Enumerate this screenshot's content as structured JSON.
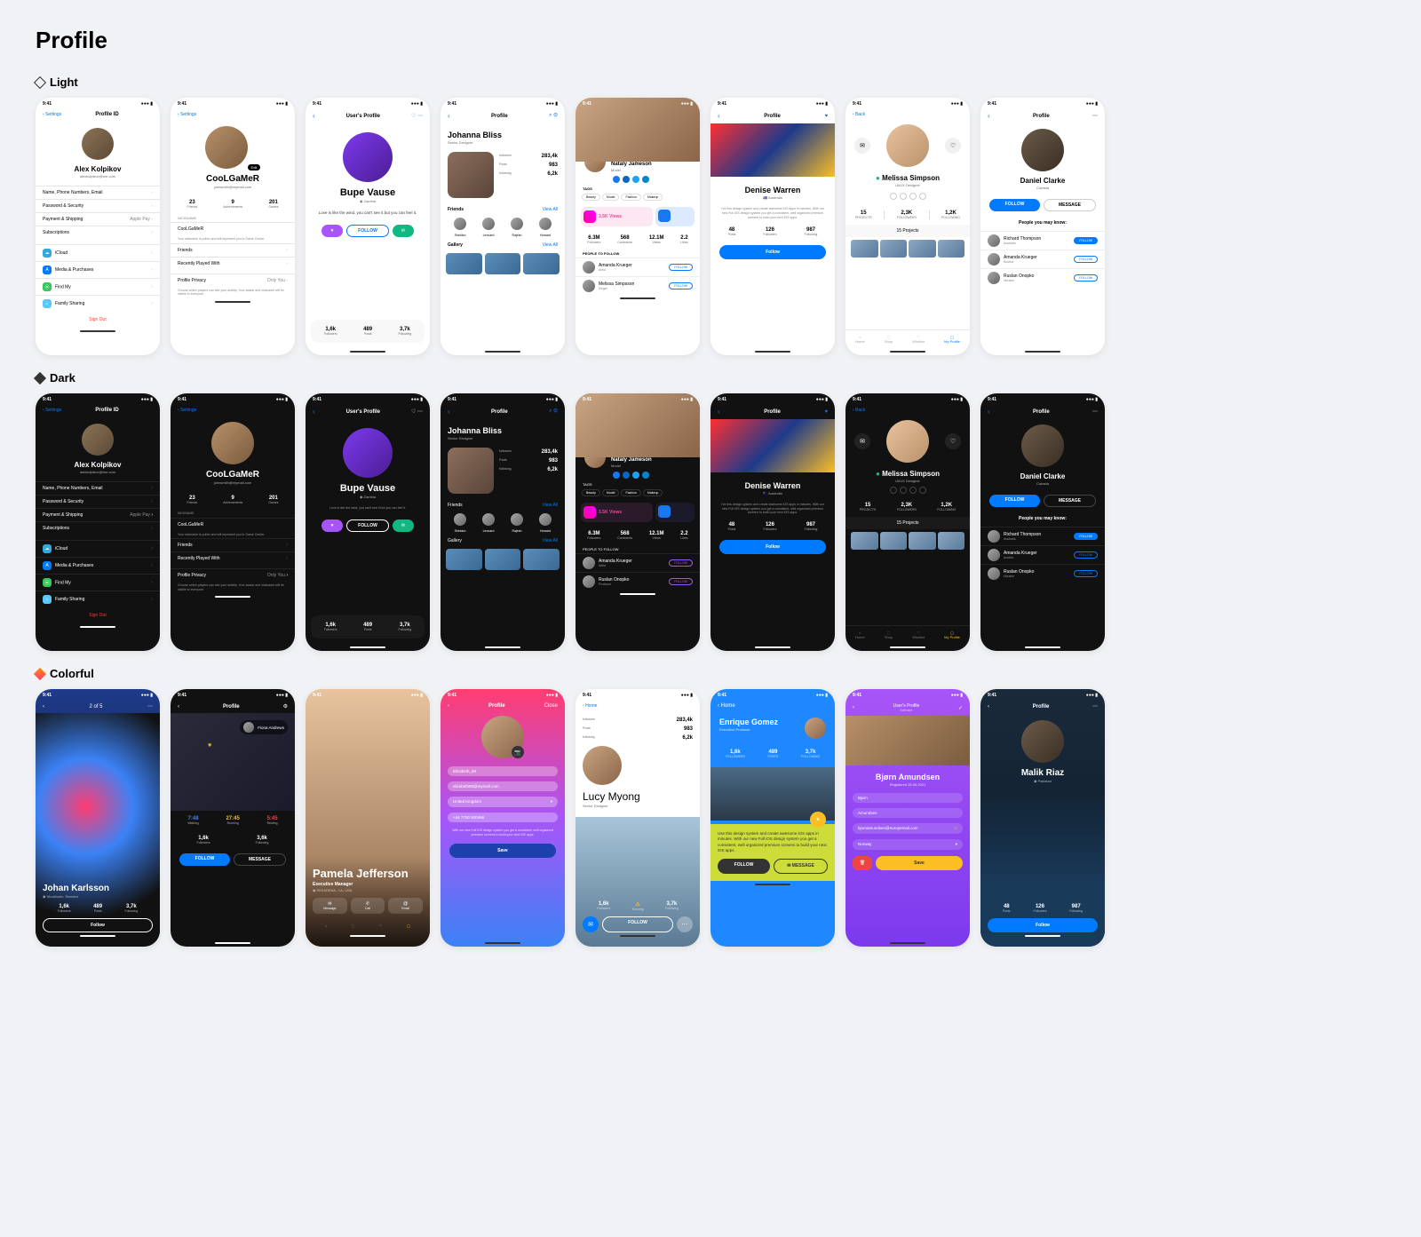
{
  "page_title": "Profile",
  "themes": {
    "light": "Light",
    "dark": "Dark",
    "colorful": "Colorful"
  },
  "time": "9:41",
  "screens": {
    "s1": {
      "back": "Settings",
      "title": "Profile ID",
      "name": "Alex Kolpikov",
      "email": "alexkolpikov@me.com",
      "rows": [
        "Name, Phone Numbers, Email",
        "Password & Security",
        "Payment & Shipping",
        "Subscriptions"
      ],
      "pay_hint": "Apple Pay",
      "services": [
        {
          "l": "iCloud",
          "c": "#34aadc"
        },
        {
          "l": "Media & Purchases",
          "c": "#007aff"
        },
        {
          "l": "Find My",
          "c": "#34c759"
        },
        {
          "l": "Family Sharing",
          "c": "#5ac8fa"
        }
      ],
      "signout": "Sign Out"
    },
    "s2": {
      "back": "Settings",
      "name": "CooLGaMeR",
      "email": "johnsmith@mymail.com",
      "stats": [
        {
          "v": "23",
          "l": "Friends"
        },
        {
          "v": "9",
          "l": "Achievements"
        },
        {
          "v": "201",
          "l": "Games"
        }
      ],
      "nick_label": "NICKNAME",
      "nick": "CooLGaMeR",
      "nick_hint": "Your nickname is public and will represent you in Game Center.",
      "rows": [
        "Friends",
        "Recently Played With"
      ],
      "privacy": "Profile Privacy",
      "privacy_val": "Only You",
      "privacy_hint": "Choose which players can see your activity. Your avatar and nickname will be visible to everyone."
    },
    "s3": {
      "title": "User's Profile",
      "name": "Bupe Vause",
      "loc": "Zambia",
      "bio": "Love is like the wind, you can't see it but you can feel it.",
      "stats": [
        {
          "v": "1,6k",
          "l": "Followers"
        },
        {
          "v": "489",
          "l": "Posts"
        },
        {
          "v": "3,7k",
          "l": "Following"
        }
      ],
      "follow": "FOLLOW"
    },
    "s4": {
      "title": "Profile",
      "name": "Johanna Bliss",
      "role": "Senior Designer",
      "metrics": [
        {
          "v": "283,4k",
          "l": "followers"
        },
        {
          "v": "983",
          "l": "Posts"
        },
        {
          "v": "6,2k",
          "l": "following"
        }
      ],
      "friends_label": "Friends",
      "viewall": "View All",
      "friends": [
        "Sheldon",
        "Leonard",
        "Rajesh",
        "Howard"
      ],
      "gallery_label": "Gallery"
    },
    "s5": {
      "name": "Nataly Jameson",
      "role": "Model",
      "tags_label": "TAGS",
      "tags": [
        "Beauty",
        "Model",
        "Fashion",
        "Makeup"
      ],
      "views": "3.5K Views",
      "views_big": "3.",
      "m": [
        {
          "v": "6.3M",
          "l": "Followers"
        },
        {
          "v": "568",
          "l": "Comments"
        },
        {
          "v": "12.1M",
          "l": "Views"
        },
        {
          "v": "2.2",
          "l": "Likes"
        }
      ],
      "ptf": "PEOPLE TO FOLLOW",
      "people": [
        {
          "n": "Amanda Krueger",
          "l": "Artist"
        },
        {
          "n": "Melissa Simpsson",
          "l": "Singer"
        }
      ],
      "follow_btn": "FOLLOW"
    },
    "s6": {
      "title": "Profile",
      "name": "Denise Warren",
      "loc": "Australia",
      "bio": "I've this design system and create awesome iOS apps in minutes. With our new Full iOS design system you get a consistent, well organized premium screens to build your next iOS apps.",
      "stats": [
        {
          "v": "48",
          "l": "Posts"
        },
        {
          "v": "126",
          "l": "Followers"
        },
        {
          "v": "987",
          "l": "Following"
        }
      ],
      "follow": "Follow"
    },
    "s7": {
      "back": "Back",
      "name": "Melissa Simpson",
      "role": "UI/UX Designer",
      "stats": [
        {
          "v": "15",
          "l": "PROJECTS"
        },
        {
          "v": "2,3K",
          "l": "FOLLOWERS"
        },
        {
          "v": "1,2K",
          "l": "FOLLOWING"
        }
      ],
      "proj": "15 Projects",
      "tabs": [
        "Home",
        "Shop",
        "Wishlist",
        "My Profile"
      ]
    },
    "s8": {
      "title": "Profile",
      "name": "Daniel Clarke",
      "loc": "Canada",
      "follow": "FOLLOW",
      "msg": "MESSAGE",
      "pymk": "People you may know:",
      "people": [
        {
          "n": "Richard Thompson",
          "l": "Australia"
        },
        {
          "n": "Amanda Krueger",
          "l": "Austria"
        },
        {
          "n": "Ruslan Onopko",
          "l": "Ukraine"
        }
      ]
    },
    "c1": {
      "name": "Johan Karlsson",
      "loc": "Stockholm, Sweden",
      "counter": "2 of 5",
      "stats": [
        {
          "v": "1,6k",
          "l": "Followers"
        },
        {
          "v": "489",
          "l": "Posts"
        },
        {
          "v": "3,7k",
          "l": "Following"
        }
      ],
      "follow": "Follow"
    },
    "c2": {
      "title": "Profile",
      "name": "Fiona Andrews",
      "activity": [
        {
          "v": "7:48",
          "l": "Walking"
        },
        {
          "v": "27:45",
          "l": "Running"
        },
        {
          "v": "5:45",
          "l": "Resting"
        }
      ],
      "stats": [
        {
          "v": "1,6k",
          "l": "Followers"
        },
        {
          "v": "3,6k",
          "l": "Following"
        }
      ],
      "follow": "FOLLOW",
      "msg": "MESSAGE"
    },
    "c3": {
      "name": "Pamela Jefferson",
      "role": "Executive Manager",
      "loc": "PASADENA, CA, USA",
      "actions": [
        "Message",
        "Call",
        "Email"
      ]
    },
    "c4": {
      "title": "Profile",
      "close": "Close",
      "username": "Elizabeth_89",
      "email": "elizabeth89@mymail.com",
      "country": "United Kingdom",
      "phone": "+44 7700 900466",
      "hint": "With our new Full iOS design system you get a consistent, well organized premium screens to build your next iOS apps.",
      "save": "Save"
    },
    "c5": {
      "home": "Home",
      "name": "Lucy Myong",
      "role": "Senior Designer",
      "metrics": [
        {
          "v": "283,4k",
          "l": "followers"
        },
        {
          "v": "983",
          "l": "Posts"
        },
        {
          "v": "6,2k",
          "l": "following"
        }
      ],
      "stats": [
        {
          "v": "1,6k",
          "l": "Followers"
        },
        {
          "v": "489",
          "l": "Running"
        },
        {
          "v": "3,7k",
          "l": "Following"
        }
      ],
      "follow": "FOLLOW"
    },
    "c6": {
      "home": "Home",
      "name": "Enrique Gomez",
      "role": "Executive Producer",
      "stats": [
        {
          "v": "1,6k",
          "l": "FOLLOWERS"
        },
        {
          "v": "489",
          "l": "POSTS"
        },
        {
          "v": "3,7k",
          "l": "FOLLOWING"
        }
      ],
      "bio": "Use this design system and create awesome iOS apps in minutes. With our new Full iOS design system you get a consistent, well organized premium screens to build your next iOS apps.",
      "follow": "FOLLOW",
      "msg": "MESSAGE"
    },
    "c7": {
      "title": "User's Profile",
      "sub": "Edit here",
      "name": "Bjørn Amundsen",
      "reg": "Registered 25.06.2021",
      "fields": {
        "fn": "Bjørn",
        "ln": "Amundsen",
        "em": "bjornamundsen@europemail.com",
        "co": "Norway"
      },
      "save": "Save"
    },
    "c8": {
      "title": "Profile",
      "name": "Malik Riaz",
      "loc": "Pakistan",
      "stats": [
        {
          "v": "48",
          "l": "Posts"
        },
        {
          "v": "126",
          "l": "Followers"
        },
        {
          "v": "987",
          "l": "Following"
        }
      ],
      "follow": "Follow"
    }
  }
}
